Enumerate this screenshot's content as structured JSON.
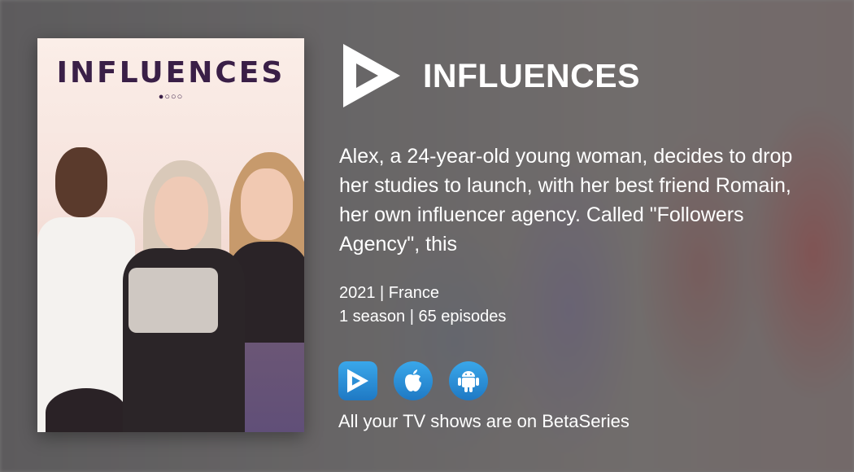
{
  "poster": {
    "title": "INFLUENCES",
    "dots": "●○○○"
  },
  "show": {
    "title": "INFLUENCES",
    "synopsis": "Alex, a 24-year-old young woman, decides to drop her studies to launch, with her best friend Romain, her own influencer agency. Called \"Followers Agency\", this",
    "year_country": "2021 | France",
    "seasons_episodes": "1 season | 65 episodes"
  },
  "apps": [
    {
      "name": "betaseries-app",
      "icon": "betaseries-play-icon"
    },
    {
      "name": "ios-app",
      "icon": "apple-icon"
    },
    {
      "name": "android-app",
      "icon": "android-icon"
    }
  ],
  "tagline": "All your TV shows are on BetaSeries",
  "colors": {
    "app_icon_blue": "#2b8fd8",
    "poster_title": "#3a1f47",
    "text": "#ffffff"
  }
}
